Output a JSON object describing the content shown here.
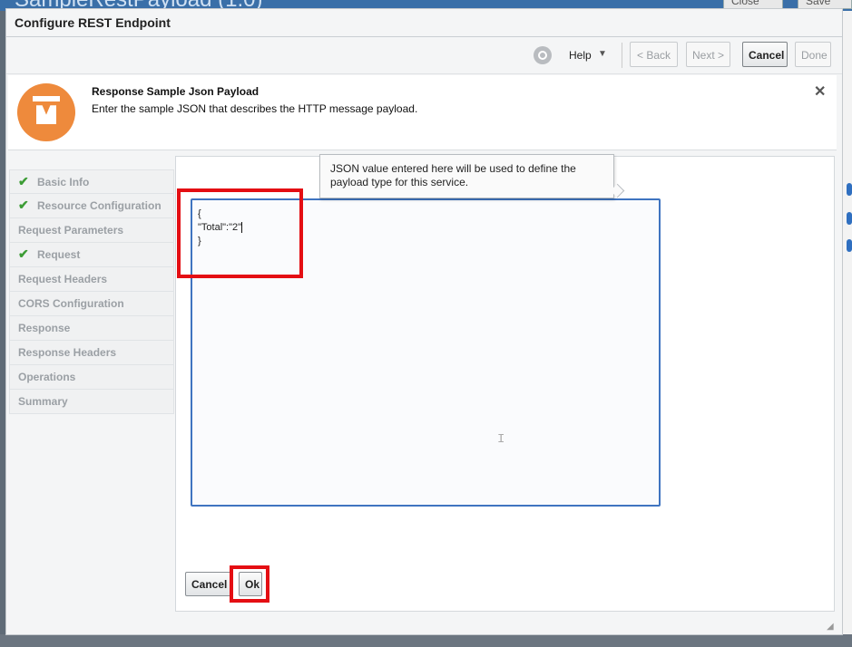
{
  "background": {
    "page_title": "SampleRestPayload (1.0)",
    "close_label": "Close",
    "save_label": "Save"
  },
  "dialog": {
    "title": "Configure REST Endpoint"
  },
  "toolbar": {
    "help_icon": "help-circle-icon",
    "help_label": "Help",
    "back_label": "< Back",
    "next_label": "Next >",
    "cancel_label": "Cancel",
    "done_label": "Done"
  },
  "banner": {
    "icon": "response-payload-icon",
    "title": "Response Sample Json Payload",
    "description": "Enter the sample JSON that describes the HTTP message payload.",
    "close_label": "✕"
  },
  "nav": {
    "items": [
      {
        "label": "Basic Info",
        "completed": true
      },
      {
        "label": "Resource Configuration",
        "completed": true
      },
      {
        "label": "Request Parameters",
        "completed": false
      },
      {
        "label": "Request",
        "completed": true
      },
      {
        "label": "Request Headers",
        "completed": false
      },
      {
        "label": "CORS Configuration",
        "completed": false
      },
      {
        "label": "Response",
        "completed": false
      },
      {
        "label": "Response Headers",
        "completed": false
      },
      {
        "label": "Operations",
        "completed": false
      },
      {
        "label": "Summary",
        "completed": false
      }
    ]
  },
  "editor": {
    "tooltip": "JSON value entered here will be used to define the payload type for this service.",
    "line1": "{",
    "line2": "\"Total\":\"2\"",
    "line3": "}",
    "cancel_label": "Cancel",
    "ok_label": "Ok"
  },
  "colors": {
    "accent_orange": "#ee8a3c",
    "highlight_red": "#e40e13",
    "editor_border": "#3f74c0",
    "check_green": "#3c9c35"
  }
}
